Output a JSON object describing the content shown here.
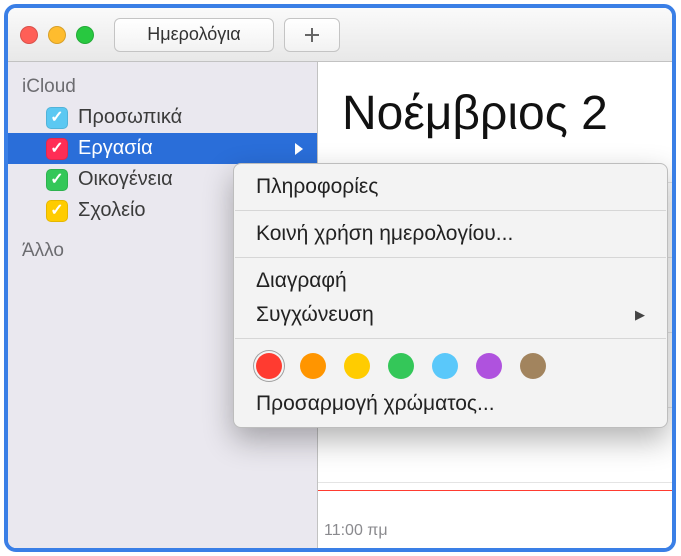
{
  "toolbar": {
    "calendars_label": "Ημερολόγια"
  },
  "sidebar": {
    "section_icloud": "iCloud",
    "section_other": "Άλλο",
    "items": [
      {
        "label": "Προσωπικά",
        "color": "#5bc8f2"
      },
      {
        "label": "Εργασία",
        "color": "#ff2d55"
      },
      {
        "label": "Οικογένεια",
        "color": "#34c759"
      },
      {
        "label": "Σχολείο",
        "color": "#ffcc00"
      }
    ]
  },
  "main": {
    "month_title": "Νοέμβριος 2",
    "time_label": "11:00 πμ"
  },
  "context_menu": {
    "info": "Πληροφορίες",
    "share": "Κοινή χρήση ημερολογίου...",
    "delete": "Διαγραφή",
    "merge": "Συγχώνευση",
    "custom_color": "Προσαρμογή χρώματος...",
    "colors": [
      "#ff3b30",
      "#ff9500",
      "#ffcc00",
      "#34c759",
      "#5ac8fa",
      "#af52de",
      "#a2845e"
    ]
  }
}
